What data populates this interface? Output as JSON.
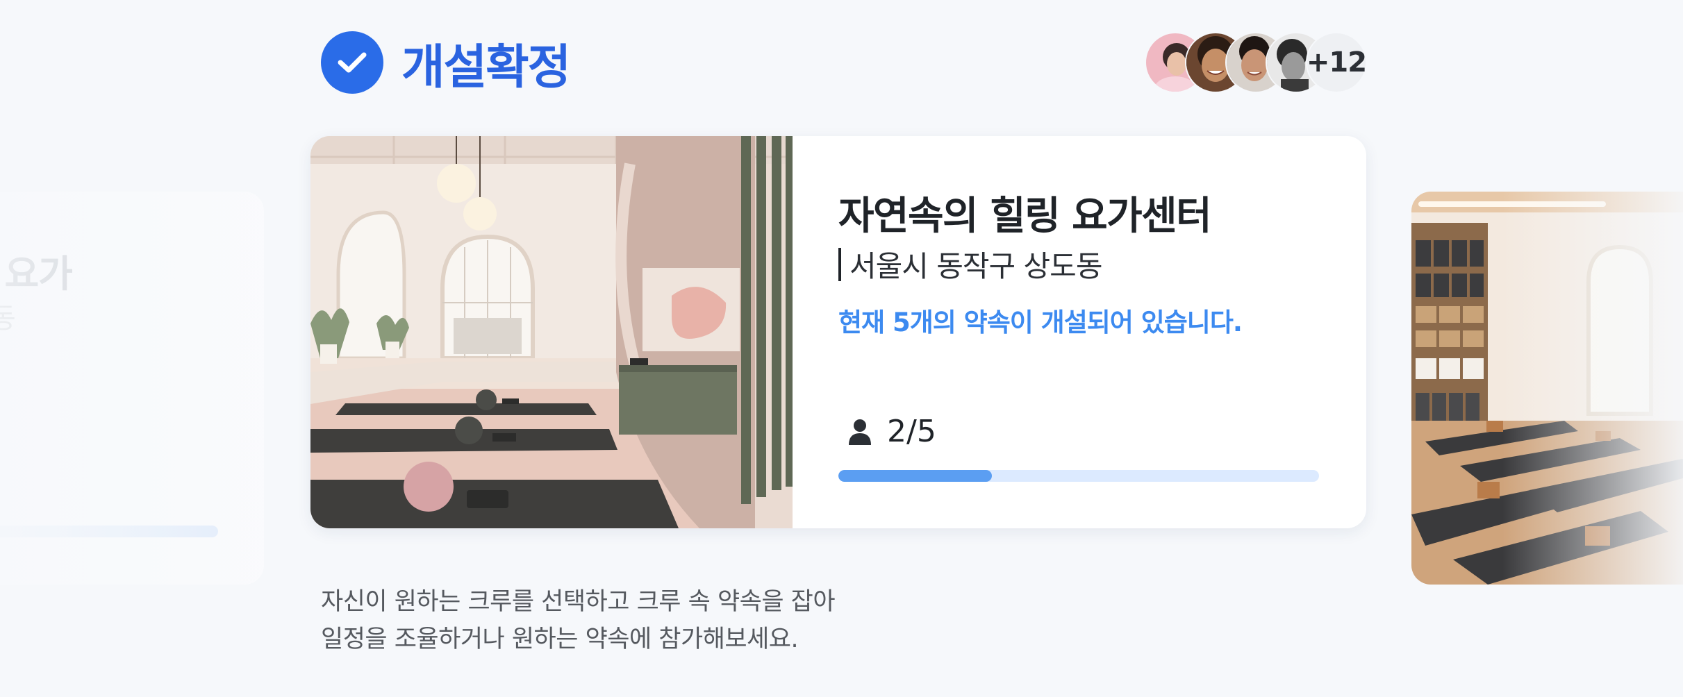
{
  "status": {
    "label": "개설확정",
    "icon": "check-circle-icon"
  },
  "participants": {
    "more_label": "+12",
    "avatar_count": 4
  },
  "card": {
    "title": "자연속의 힐링 요가센터",
    "location": "서울시 동작구 상도동",
    "note": "현재 5개의 약속이 개설되어 있습니다.",
    "members_label": "2/5",
    "members_current": 2,
    "members_max": 5,
    "progress_fraction": 0.32,
    "image": "yoga-studio-photo"
  },
  "description": {
    "line1": "자신이 원하는 크루를 선택하고 크루 속 약속을 잡아",
    "line2": "일정을 조율하거나 원하는 약속에 참가해보세요."
  },
  "ghost_left": {
    "title": "의 요가",
    "sub": "동"
  },
  "colors": {
    "accent": "#2a6ce8",
    "note": "#3c8af0",
    "progress_track": "#dceaff",
    "progress_fill": "#5b9ef2"
  }
}
